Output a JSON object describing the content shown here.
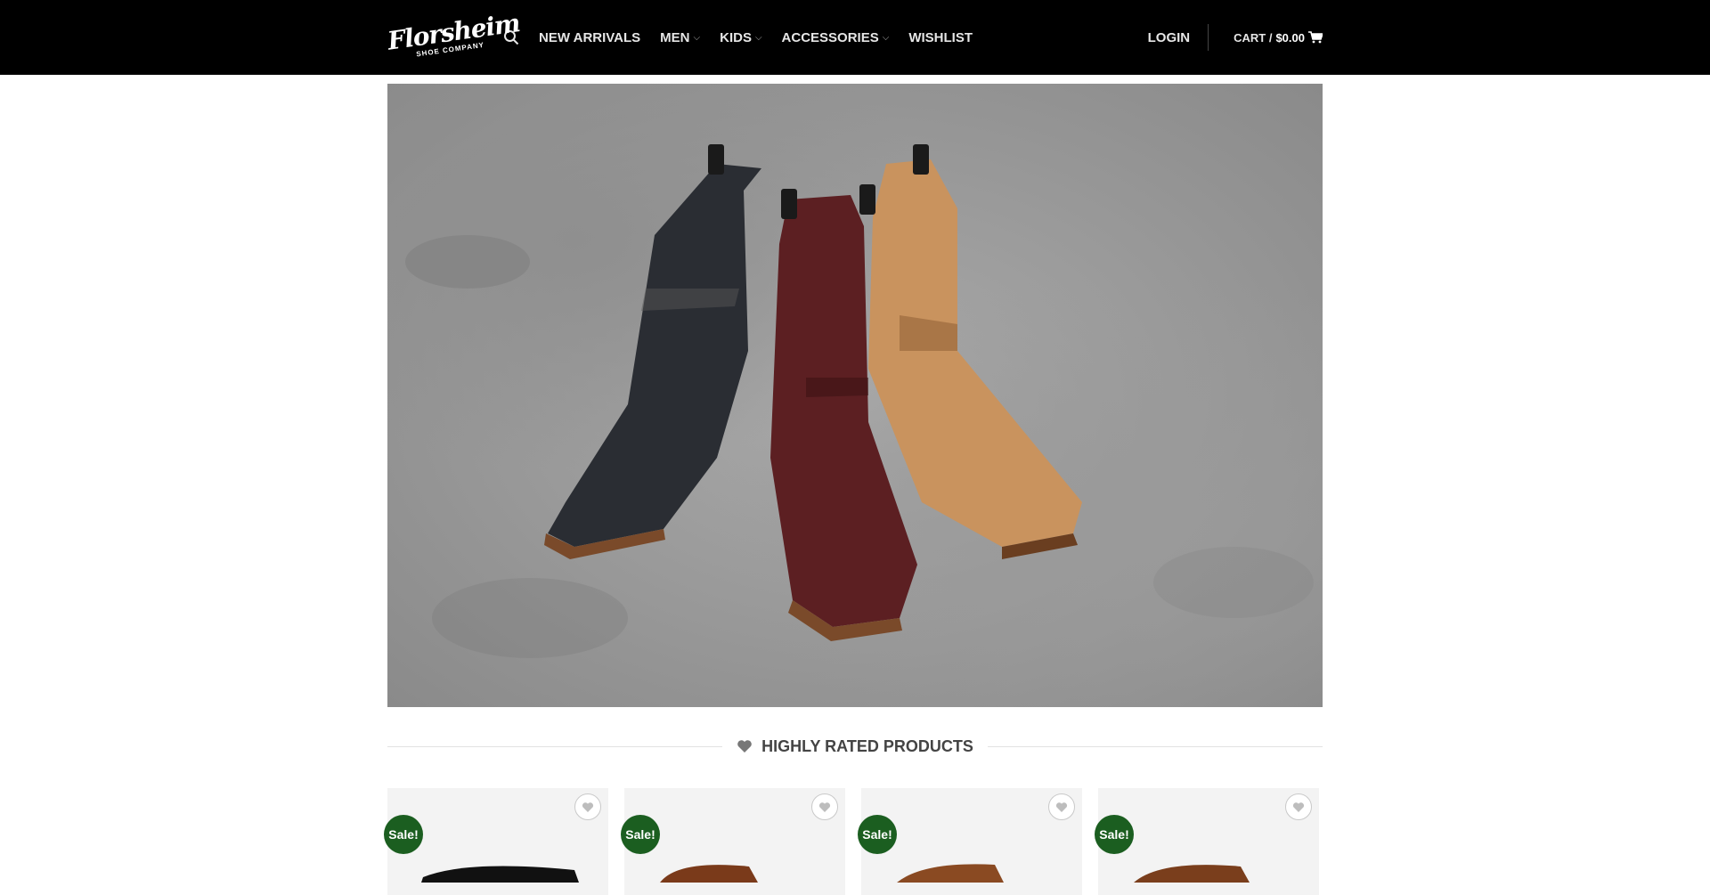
{
  "brand": {
    "logo_script": "Florsheim",
    "logo_sub": "SHOE COMPANY"
  },
  "header": {
    "nav": [
      {
        "label": "NEW ARRIVALS",
        "has_dropdown": false
      },
      {
        "label": "MEN",
        "has_dropdown": true
      },
      {
        "label": "KIDS",
        "has_dropdown": true
      },
      {
        "label": "ACCESSORIES",
        "has_dropdown": true
      },
      {
        "label": "WISHLIST",
        "has_dropdown": false
      }
    ],
    "login": "LOGIN",
    "cart_label": "CART /",
    "cart_amount": "$0.00"
  },
  "section": {
    "title": "HIGHLY RATED PRODUCTS",
    "icon": "heart-icon"
  },
  "products": [
    {
      "badge": "Sale!",
      "shoe_color": "#111111"
    },
    {
      "badge": "Sale!",
      "shoe_color": "#7a3a1a"
    },
    {
      "badge": "Sale!",
      "shoe_color": "#8a4a22"
    },
    {
      "badge": "Sale!",
      "shoe_color": "#7a3e1c"
    }
  ],
  "colors": {
    "header_bg": "#000000",
    "sale_badge": "#1b5e20"
  }
}
